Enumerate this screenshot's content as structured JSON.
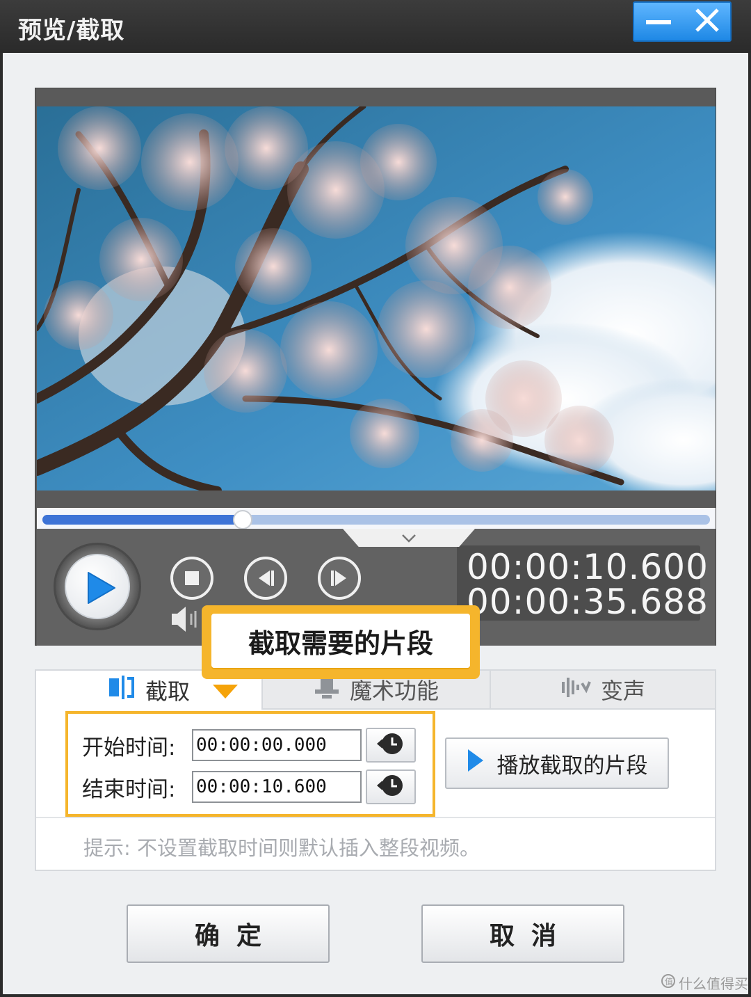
{
  "window": {
    "title": "预览/截取",
    "minimize_icon": "minimize-icon",
    "close_icon": "close-icon",
    "accent": "#2b90ea"
  },
  "player": {
    "progress_fraction": 0.3,
    "current_time": "00:00:10.600",
    "total_time": "00:00:35.688",
    "play_icon": "play-icon",
    "stop_icon": "stop-icon",
    "prev_frame_icon": "prev-frame-icon",
    "next_frame_icon": "next-frame-icon",
    "volume_icon": "volume-icon",
    "collapse_icon": "chevron-down-icon"
  },
  "callout": {
    "text": "截取需要的片段",
    "color": "#f5b52c"
  },
  "tabs": [
    {
      "label": "截取",
      "icon": "trim-icon"
    },
    {
      "label": "魔术功能",
      "icon": "magic-hat-icon"
    },
    {
      "label": "变声",
      "icon": "audio-wave-icon"
    }
  ],
  "trim": {
    "start_label": "开始时间:",
    "start_value": "00:00:00.000",
    "end_label": "结束时间:",
    "end_value": "00:00:10.600",
    "set_current_icon": "clock-rewind-icon",
    "play_segment_label": "播放截取的片段",
    "hint": "提示: 不设置截取时间则默认插入整段视频。"
  },
  "buttons": {
    "ok": "确定",
    "cancel": "取消"
  },
  "watermark": "什么值得买"
}
